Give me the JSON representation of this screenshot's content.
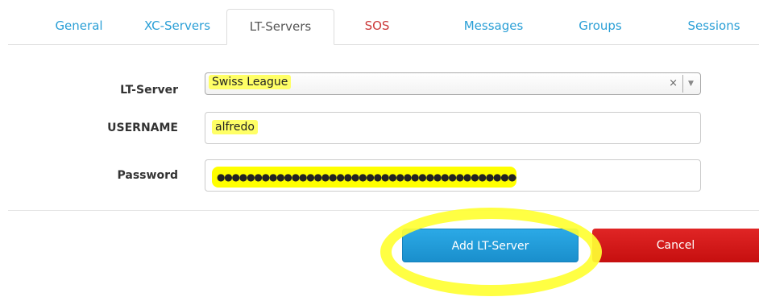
{
  "tabs": [
    {
      "label": "General"
    },
    {
      "label": "XC-Servers"
    },
    {
      "label": "LT-Servers"
    },
    {
      "label": "SOS"
    },
    {
      "label": "Messages"
    },
    {
      "label": "Groups"
    },
    {
      "label": "Sessions"
    }
  ],
  "active_tab": "LT-Servers",
  "form": {
    "lt_server_label": "LT-Server",
    "lt_server_value": "Swiss League",
    "lt_server_clear": "×",
    "lt_server_arrow": "▼",
    "username_label": "USERNAME",
    "username_value": "alfredo",
    "password_label": "Password",
    "password_value": "●●●●●●●●●●●●●●●●●●●●●●●●●●●●●●●●●●●●●●●●●●"
  },
  "buttons": {
    "add_label": "Add LT-Server",
    "cancel_label": "Cancel"
  },
  "colors": {
    "link": "#2a9fd6",
    "sos": "#cc3a3a",
    "primary": "#2ba9e6",
    "danger": "#d91a1a",
    "highlight": "#ffff00"
  }
}
